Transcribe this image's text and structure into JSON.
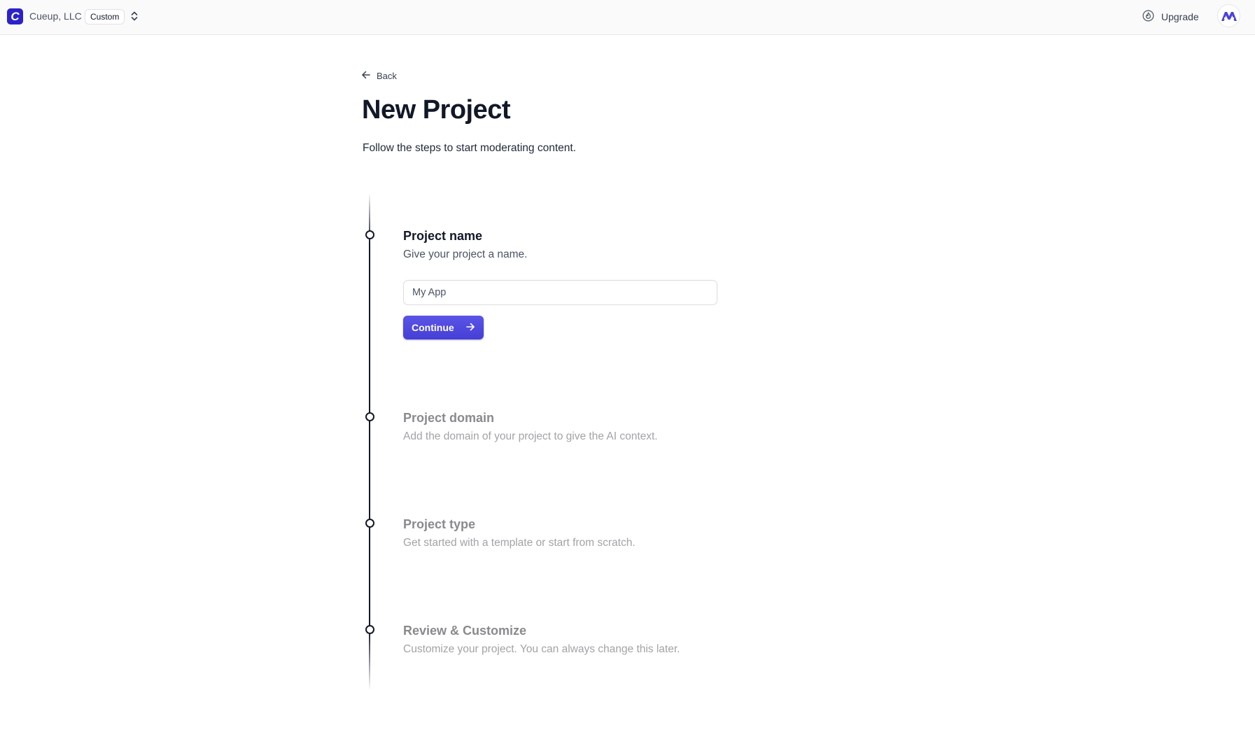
{
  "header": {
    "org_logo_letter": "C",
    "org_name": "Cueup, LLC",
    "plan_badge": "Custom",
    "upgrade_label": "Upgrade",
    "icons": {
      "switcher": "chevron-up-down-icon",
      "upgrade": "flame-icon",
      "avatar": "user-avatar-logo"
    }
  },
  "page": {
    "back_label": "Back",
    "title": "New Project",
    "subtitle": "Follow the steps to start moderating content."
  },
  "steps": [
    {
      "title": "Project name",
      "description": "Give your project a name.",
      "state": "active",
      "input": {
        "value": "",
        "placeholder": "My App"
      },
      "button_label": "Continue"
    },
    {
      "title": "Project domain",
      "description": "Add the domain of your project to give the AI context.",
      "state": "inactive"
    },
    {
      "title": "Project type",
      "description": "Get started with a template or start from scratch.",
      "state": "inactive"
    },
    {
      "title": "Review & Customize",
      "description": "Customize your project. You can always change this later.",
      "state": "inactive"
    }
  ],
  "colors": {
    "brand": "#2c22c9",
    "primary_button": "#4f49df",
    "text_primary": "#111827",
    "text_muted": "#8a8a8e"
  }
}
